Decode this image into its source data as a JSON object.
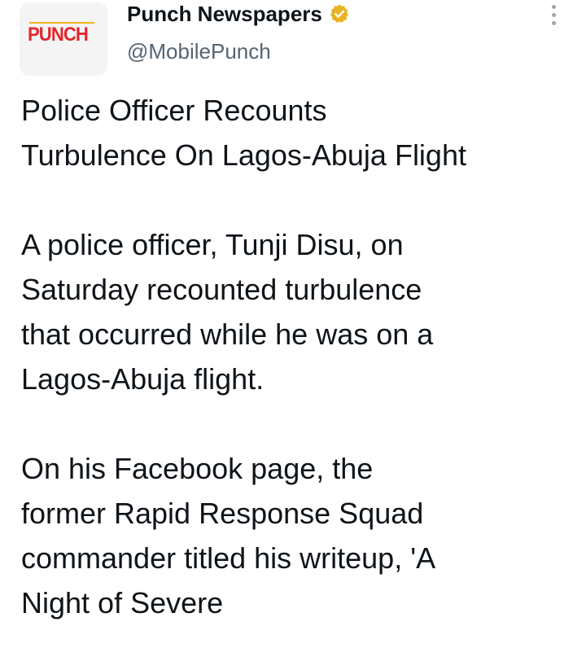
{
  "author": {
    "avatar_logo": "PUNCH",
    "display_name": "Punch Newspapers",
    "verified_icon": "verified-badge-gold-icon",
    "handle": "@MobilePunch",
    "accent_color": "#e2262c",
    "badge_color": "#e8b323"
  },
  "menu": {
    "icon": "more-vertical-icon"
  },
  "tweet": {
    "lines": [
      "Police Officer Recounts",
      "Turbulence On Lagos-Abuja Flight",
      "",
      "A police officer, Tunji Disu, on",
      "Saturday recounted turbulence",
      "that occurred while he was on a",
      "Lagos-Abuja flight.",
      "",
      "On his Facebook page, the",
      "former Rapid Response Squad",
      "commander titled his writeup, 'A",
      "Night of Severe"
    ]
  }
}
